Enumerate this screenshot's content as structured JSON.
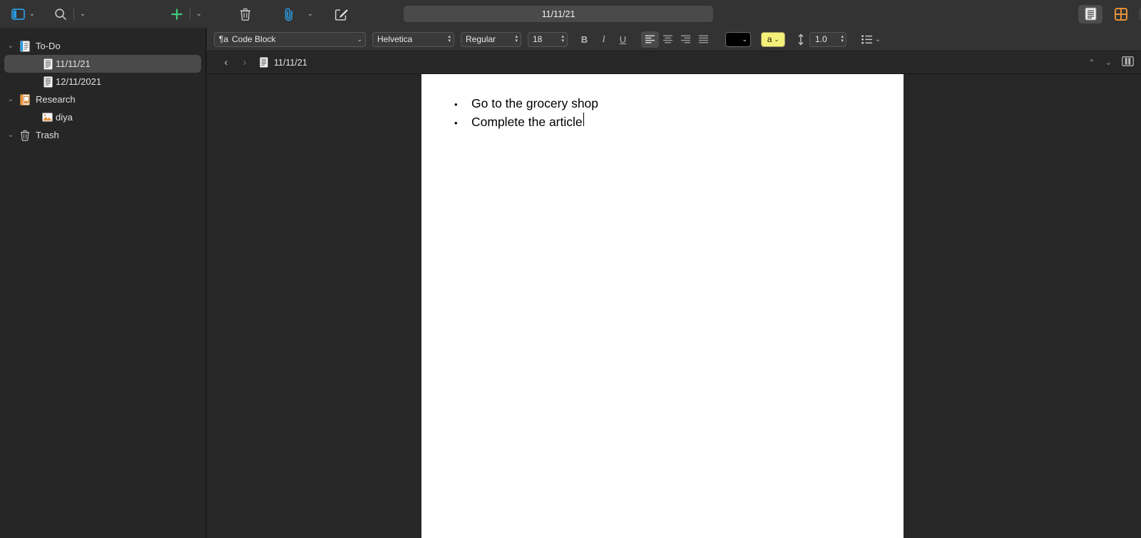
{
  "toolbar": {
    "sidebar_toggle_icon": "sidebar-panel-icon",
    "sidebar_toggle_chevron": "⌄",
    "search_icon": "search-icon",
    "search_chevron": "⌄",
    "add_icon": "+",
    "add_chevron": "⌄",
    "trash_icon": "trash-icon",
    "attach_icon": "paperclip-icon",
    "attach_chevron": "⌄",
    "compose_icon": "compose-icon",
    "title_value": "11/11/21",
    "view_document_icon": "document-view-icon",
    "view_grid_icon": "grid-view-icon",
    "view_list_icon": "list-view-icon",
    "share_icon": "share-icon",
    "bookmark_icon": "bookmark-icon",
    "appearance_icon": "appearance-toggle-icon",
    "info_icon": "info-icon",
    "accent_green": "#41c97e",
    "accent_blue": "#2b9ae0",
    "accent_orange": "#e8903a",
    "accent_red": "#f2594b"
  },
  "format_bar": {
    "paragraph_style": "Code Block",
    "paragraph_style_prefix": "¶a",
    "font_family": "Helvetica",
    "font_weight": "Regular",
    "font_size": "18",
    "bold_label": "B",
    "italic_label": "I",
    "underline_label": "U",
    "align_left_icon": "align-left-icon",
    "align_center_icon": "align-center-icon",
    "align_right_icon": "align-right-icon",
    "align_justify_icon": "align-justify-icon",
    "text_color_swatch": "#000000",
    "highlight_label": "a",
    "highlight_color": "#f5f07a",
    "line_spacing_icon": "line-spacing-icon",
    "line_spacing_value": "1.0",
    "list_icon": "bullet-list-icon",
    "list_chevron": "⌄",
    "dropdown_chevron": "⌄",
    "stepper_up": "▴",
    "stepper_down": "▾"
  },
  "sidebar": {
    "items": [
      {
        "label": "To-Do",
        "icon": "notebook-blue-icon",
        "level": 0,
        "disclosure": "⌄",
        "selected": false
      },
      {
        "label": "11/11/21",
        "icon": "note-document-icon",
        "level": 1,
        "disclosure": "",
        "selected": true
      },
      {
        "label": "12/11/2021",
        "icon": "note-document-icon",
        "level": 1,
        "disclosure": "",
        "selected": false
      },
      {
        "label": "Research",
        "icon": "notebook-orange-icon",
        "level": 0,
        "disclosure": "⌄",
        "selected": false
      },
      {
        "label": "diya",
        "icon": "image-icon",
        "level": 1,
        "disclosure": "",
        "selected": false
      },
      {
        "label": "Trash",
        "icon": "trash-icon",
        "level": 0,
        "disclosure": "⌄",
        "selected": false
      }
    ]
  },
  "breadcrumb": {
    "back_arrow": "‹",
    "forward_arrow": "›",
    "doc_icon": "note-document-icon",
    "title": "11/11/21",
    "prev_icon": "chevron-up-icon",
    "next_icon": "chevron-down-icon",
    "split_icon": "split-view-icon"
  },
  "document": {
    "bullet_char": "•",
    "lines": [
      "Go to the grocery shop",
      "Complete the article"
    ]
  }
}
